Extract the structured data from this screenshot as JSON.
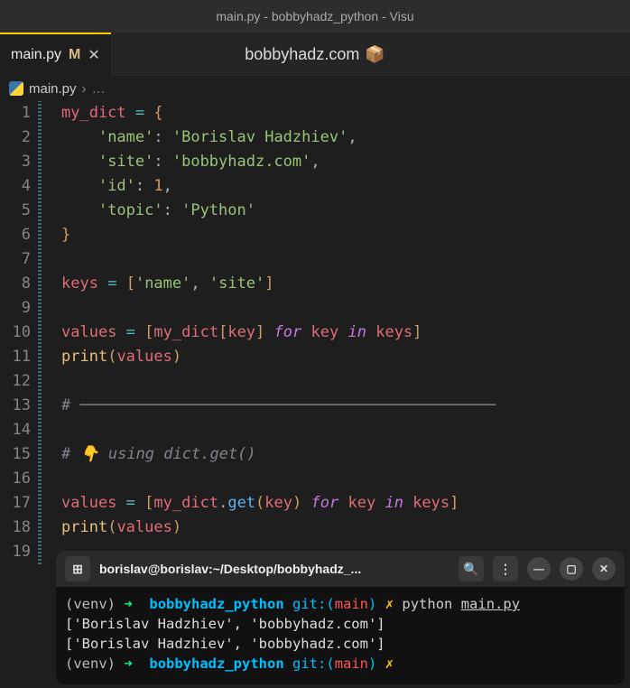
{
  "window": {
    "title": "main.py - bobbyhadz_python - Visu"
  },
  "tab": {
    "filename": "main.py",
    "modified_indicator": "M",
    "close": "✕"
  },
  "watermark": {
    "text": "bobbyhadz.com",
    "icon": "📦"
  },
  "breadcrumb": {
    "file": "main.py",
    "chevron": "›",
    "dots": "…"
  },
  "code": {
    "lines": [
      {
        "n": 1,
        "indent": 0,
        "tokens": [
          [
            "var",
            "my_dict"
          ],
          [
            "punc",
            " "
          ],
          [
            "op",
            "="
          ],
          [
            "punc",
            " "
          ],
          [
            "brace",
            "{"
          ]
        ]
      },
      {
        "n": 2,
        "indent": 1,
        "tokens": [
          [
            "str",
            "'name'"
          ],
          [
            "punc",
            ": "
          ],
          [
            "str",
            "'Borislav Hadzhiev'"
          ],
          [
            "punc",
            ","
          ]
        ]
      },
      {
        "n": 3,
        "indent": 1,
        "tokens": [
          [
            "str",
            "'site'"
          ],
          [
            "punc",
            ": "
          ],
          [
            "str",
            "'bobbyhadz.com'"
          ],
          [
            "punc",
            ","
          ]
        ]
      },
      {
        "n": 4,
        "indent": 1,
        "tokens": [
          [
            "str",
            "'id'"
          ],
          [
            "punc",
            ": "
          ],
          [
            "num",
            "1"
          ],
          [
            "punc",
            ","
          ]
        ]
      },
      {
        "n": 5,
        "indent": 1,
        "tokens": [
          [
            "str",
            "'topic'"
          ],
          [
            "punc",
            ": "
          ],
          [
            "str",
            "'Python'"
          ]
        ]
      },
      {
        "n": 6,
        "indent": 0,
        "tokens": [
          [
            "brace",
            "}"
          ]
        ]
      },
      {
        "n": 7,
        "indent": 0,
        "tokens": []
      },
      {
        "n": 8,
        "indent": 0,
        "tokens": [
          [
            "var",
            "keys"
          ],
          [
            "punc",
            " "
          ],
          [
            "op",
            "="
          ],
          [
            "punc",
            " "
          ],
          [
            "brace",
            "["
          ],
          [
            "str",
            "'name'"
          ],
          [
            "punc",
            ", "
          ],
          [
            "str",
            "'site'"
          ],
          [
            "brace",
            "]"
          ]
        ]
      },
      {
        "n": 9,
        "indent": 0,
        "tokens": []
      },
      {
        "n": 10,
        "indent": 0,
        "tokens": [
          [
            "var",
            "values"
          ],
          [
            "punc",
            " "
          ],
          [
            "op",
            "="
          ],
          [
            "punc",
            " "
          ],
          [
            "brace",
            "["
          ],
          [
            "var",
            "my_dict"
          ],
          [
            "brace",
            "["
          ],
          [
            "var",
            "key"
          ],
          [
            "brace",
            "]"
          ],
          [
            "punc",
            " "
          ],
          [
            "kw",
            "for"
          ],
          [
            "punc",
            " "
          ],
          [
            "var",
            "key"
          ],
          [
            "punc",
            " "
          ],
          [
            "kw",
            "in"
          ],
          [
            "punc",
            " "
          ],
          [
            "var",
            "keys"
          ],
          [
            "brace",
            "]"
          ]
        ]
      },
      {
        "n": 11,
        "indent": 0,
        "tokens": [
          [
            "builtin",
            "print"
          ],
          [
            "brace",
            "("
          ],
          [
            "var",
            "values"
          ],
          [
            "brace",
            ")"
          ]
        ]
      },
      {
        "n": 12,
        "indent": 0,
        "tokens": []
      },
      {
        "n": 13,
        "indent": 0,
        "tokens": [
          [
            "comment",
            "# ─────────────────────────────────────────────"
          ]
        ]
      },
      {
        "n": 14,
        "indent": 0,
        "tokens": []
      },
      {
        "n": 15,
        "indent": 0,
        "tokens": [
          [
            "comment",
            "# 👇 using dict.get()"
          ]
        ]
      },
      {
        "n": 16,
        "indent": 0,
        "tokens": []
      },
      {
        "n": 17,
        "indent": 0,
        "tokens": [
          [
            "var",
            "values"
          ],
          [
            "punc",
            " "
          ],
          [
            "op",
            "="
          ],
          [
            "punc",
            " "
          ],
          [
            "brace",
            "["
          ],
          [
            "var",
            "my_dict"
          ],
          [
            "punc",
            "."
          ],
          [
            "func",
            "get"
          ],
          [
            "brace",
            "("
          ],
          [
            "var",
            "key"
          ],
          [
            "brace",
            ")"
          ],
          [
            "punc",
            " "
          ],
          [
            "kw",
            "for"
          ],
          [
            "punc",
            " "
          ],
          [
            "var",
            "key"
          ],
          [
            "punc",
            " "
          ],
          [
            "kw",
            "in"
          ],
          [
            "punc",
            " "
          ],
          [
            "var",
            "keys"
          ],
          [
            "brace",
            "]"
          ]
        ]
      },
      {
        "n": 18,
        "indent": 0,
        "tokens": [
          [
            "builtin",
            "print"
          ],
          [
            "brace",
            "("
          ],
          [
            "var",
            "values"
          ],
          [
            "brace",
            ")"
          ]
        ]
      },
      {
        "n": 19,
        "indent": 0,
        "tokens": []
      }
    ]
  },
  "terminal": {
    "title": "borislav@borislav:~/Desktop/bobbyhadz_...",
    "icons": {
      "new_tab": "⊞",
      "search": "🔍",
      "menu": "⋮",
      "minimize": "—",
      "maximize": "▢",
      "close": "✕"
    },
    "lines": [
      {
        "type": "prompt",
        "venv": "(venv)",
        "arrow": "➜",
        "dir": "bobbyhadz_python",
        "git": "git:(",
        "branch": "main",
        "gitclose": ")",
        "x": "✗",
        "cmd": "python ",
        "file": "main.py"
      },
      {
        "type": "output",
        "text": "['Borislav Hadzhiev', 'bobbyhadz.com']"
      },
      {
        "type": "output",
        "text": "['Borislav Hadzhiev', 'bobbyhadz.com']"
      },
      {
        "type": "prompt",
        "venv": "(venv)",
        "arrow": "➜",
        "dir": "bobbyhadz_python",
        "git": "git:(",
        "branch": "main",
        "gitclose": ")",
        "x": "✗",
        "cmd": "",
        "file": ""
      }
    ]
  }
}
